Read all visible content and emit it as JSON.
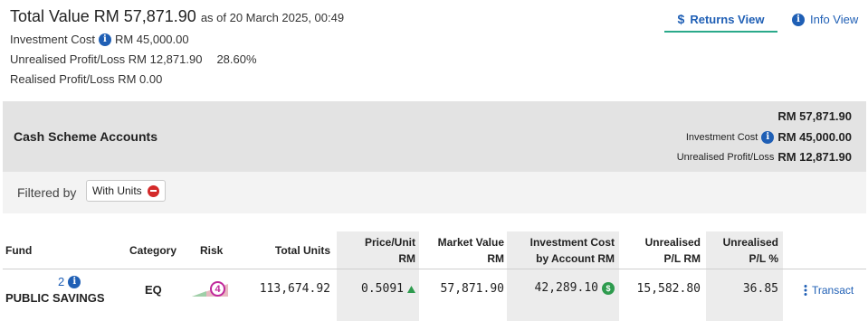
{
  "summary": {
    "total_label": "Total Value RM 57,871.90",
    "as_of": "as of 20 March 2025, 00:49",
    "investment_cost_label": "Investment Cost",
    "investment_cost_value": "RM 45,000.00",
    "unrealised_label": "Unrealised Profit/Loss RM 12,871.90",
    "unrealised_pct": "28.60%",
    "realised_label": "Realised Profit/Loss RM 0.00"
  },
  "views": {
    "returns_view": "Returns View",
    "info_view": "Info View",
    "returns_icon": "$",
    "info_icon": "i"
  },
  "account": {
    "title": "Cash Scheme Accounts",
    "total": "RM 57,871.90",
    "investment_cost_label": "Investment Cost",
    "investment_cost_value": "RM 45,000.00",
    "unrealised_label": "Unrealised Profit/Loss",
    "unrealised_value": "RM 12,871.90"
  },
  "filter": {
    "label": "Filtered by",
    "chip": "With Units"
  },
  "table": {
    "headers": {
      "fund": "Fund",
      "category": "Category",
      "risk": "Risk",
      "total_units": "Total Units",
      "price_line1": "Price/Unit",
      "price_line2": "RM",
      "market_line1": "Market Value",
      "market_line2": "RM",
      "cost_line1": "Investment Cost",
      "cost_line2": "by Account RM",
      "upl_line1": "Unrealised",
      "upl_line2": "P/L RM",
      "uplp_line1": "Unrealised",
      "uplp_line2": "P/L %"
    },
    "rows": [
      {
        "fund_count": "2",
        "fund_name": "PUBLIC SAVINGS",
        "category": "EQ",
        "risk_level": "4",
        "total_units": "113,674.92",
        "price": "0.5091",
        "market_value": "57,871.90",
        "investment_cost": "42,289.10",
        "unrealised_pl": "15,582.80",
        "unrealised_pct": "36.85",
        "action": "Transact"
      }
    ]
  },
  "colors": {
    "accent_blue": "#1f5fb5",
    "tab_underline": "#2aa98a",
    "up_green": "#2e9b4e",
    "risk_pink": "#c0289b",
    "remove_red": "#d42a2a"
  }
}
